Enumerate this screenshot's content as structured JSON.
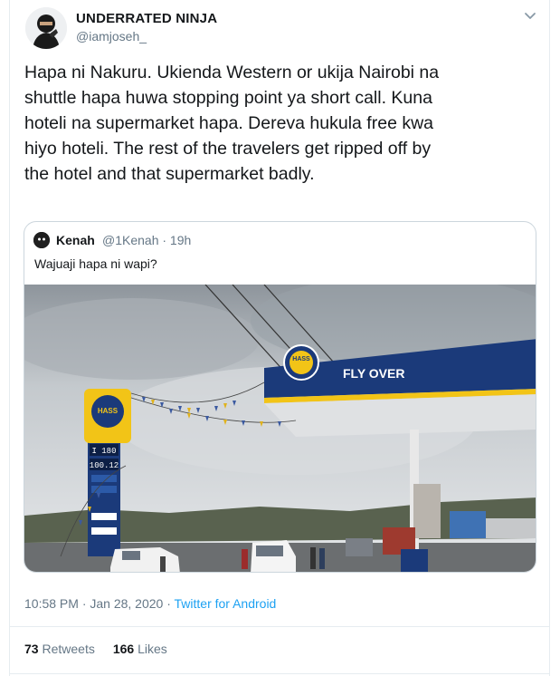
{
  "author": {
    "display_name": "UNDERRATED NINJA",
    "handle": "@iamjoseh_",
    "avatar_icon": "ninja-avatar"
  },
  "tweet": {
    "text": "Hapa ni Nakuru. Ukienda Western or ukija Nairobi na\nshuttle hapa huwa stopping point ya short call. Kuna\nhoteli na supermarket hapa. Dereva hukula free kwa\nhiyo hoteli. The rest of the travelers get ripped off by\nthe hotel and that supermarket badly.",
    "caret_icon": "chevron-down-icon"
  },
  "quoted_tweet": {
    "name": "Kenah",
    "meta": "@1Kenah · 19h",
    "text": "Wajuaji hapa ni wapi?",
    "photo": {
      "canopy_label": "FLY OVER",
      "logo_text": "HASS",
      "price_1": "I 180",
      "price_2": "100.12"
    }
  },
  "footer": {
    "time": "10:58 PM · Jan 28, 2020 · ",
    "source": "Twitter for Android"
  },
  "stats": {
    "retweets_count": "73",
    "retweets_label": "Retweets",
    "likes_count": "166",
    "likes_label": "Likes"
  },
  "colors": {
    "link": "#1da1f2",
    "muted": "#657786",
    "text": "#14171a",
    "canopy": "#1b3a7a",
    "canopy_stripe": "#f2c417"
  }
}
